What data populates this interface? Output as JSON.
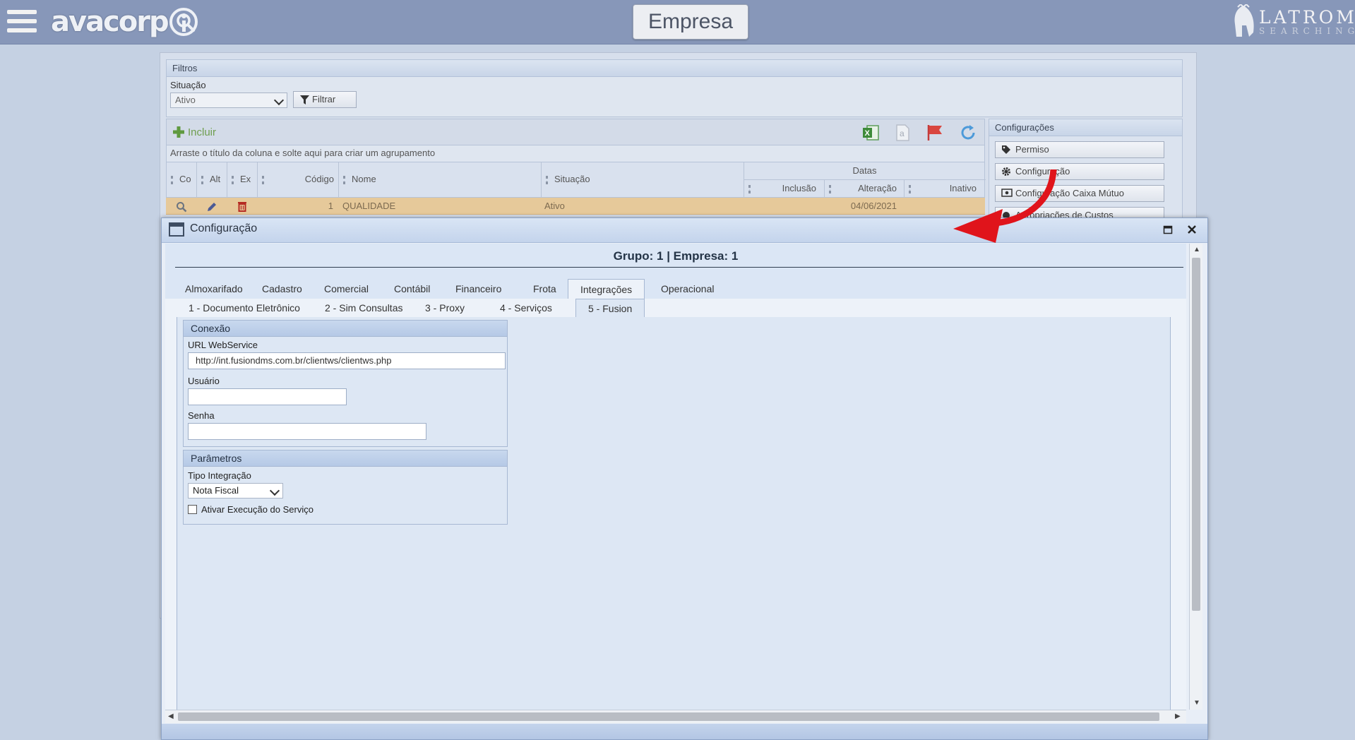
{
  "app": {
    "logo_text": "avacorp",
    "page_title": "Empresa",
    "brand_name": "LATROMI",
    "brand_sub": "SEARCHING"
  },
  "filters": {
    "title": "Filtros",
    "situacao_label": "Situação",
    "situacao_value": "Ativo",
    "filter_button": "Filtrar"
  },
  "grid": {
    "include_button": "Incluir",
    "group_hint": "Arraste o título da coluna e solte aqui para criar um agrupamento",
    "columns": {
      "consultar": "Co",
      "alterar": "Alt",
      "excluir": "Ex",
      "codigo": "Código",
      "nome": "Nome",
      "situacao": "Situação",
      "datas": "Datas",
      "inclusao": "Inclusão",
      "alteracao": "Alteração",
      "inativo": "Inativo"
    },
    "rows": [
      {
        "codigo": "1",
        "nome": "QUALIDADE",
        "situacao": "Ativo",
        "inclusao": "",
        "alteracao": "04/06/2021",
        "inativo": ""
      }
    ]
  },
  "config_side": {
    "title": "Configurações",
    "buttons": [
      "Permiso",
      "Configuração",
      "Configuração Caixa Mútuo",
      "Apropriações de Custos"
    ]
  },
  "dialog": {
    "title": "Configuração",
    "heading": "Grupo: 1 | Empresa: 1",
    "tabs": [
      "Almoxarifado",
      "Cadastro",
      "Comercial",
      "Contábil",
      "Financeiro",
      "Frota",
      "Integrações",
      "Operacional"
    ],
    "active_tab": "Integrações",
    "subtabs": [
      "1 - Documento Eletrônico",
      "2 - Sim Consultas",
      "3 - Proxy",
      "4 - Serviços",
      "5 - Fusion"
    ],
    "active_subtab": "5 - Fusion",
    "conexao": {
      "title": "Conexão",
      "url_label": "URL WebService",
      "url_value": "http://int.fusiondms.com.br/clientws/clientws.php",
      "usuario_label": "Usuário",
      "usuario_value": "",
      "senha_label": "Senha",
      "senha_value": ""
    },
    "parametros": {
      "title": "Parâmetros",
      "tipo_label": "Tipo Integração",
      "tipo_value": "Nota Fiscal",
      "ativar_label": "Ativar Execução do Serviço",
      "ativar_checked": false
    }
  },
  "colors": {
    "topbar": "#8797b9",
    "row_highlight": "#e6c99a",
    "include_green": "#6f9e4f",
    "arrow_red": "#e0141b"
  }
}
